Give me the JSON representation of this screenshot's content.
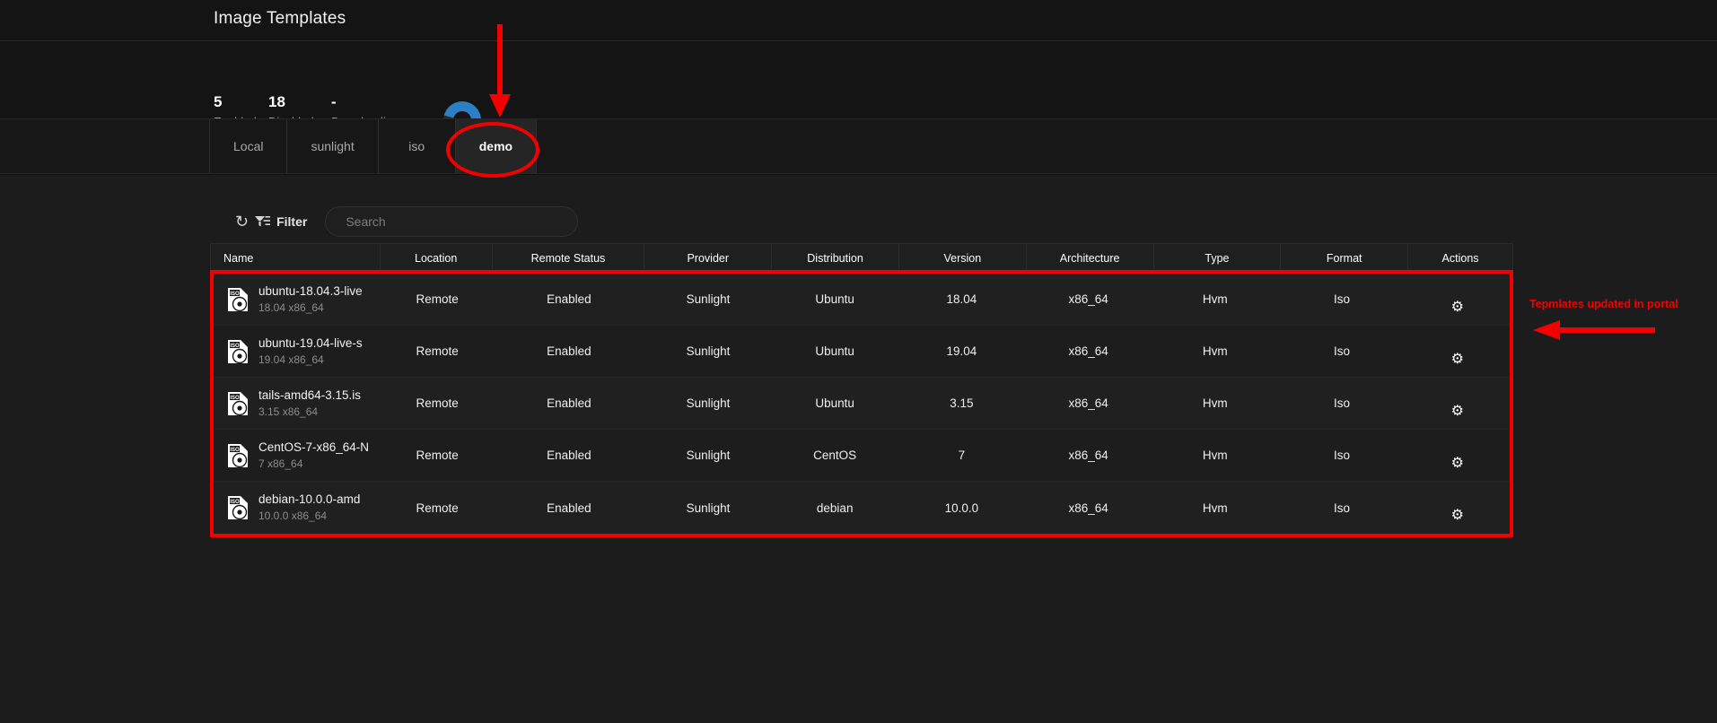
{
  "header": {
    "title": "Image Templates"
  },
  "stats": [
    {
      "value": "5",
      "label": "Enabled"
    },
    {
      "value": "18",
      "label": "Disabled"
    },
    {
      "value": "-",
      "label": "Downloading"
    }
  ],
  "donut": {
    "icon": "donut-chart-icon",
    "color": "#2b7fc4",
    "track_color": "#2a2a2a"
  },
  "tabs": [
    {
      "label": "Local",
      "active": false
    },
    {
      "label": "sunlight",
      "active": false
    },
    {
      "label": "iso",
      "active": false
    },
    {
      "label": "demo",
      "active": true
    }
  ],
  "toolbar": {
    "refresh_icon": "refresh-icon",
    "filter_icon": "filter-icon",
    "filter_label": "Filter",
    "search_value": "",
    "search_placeholder": "Search"
  },
  "table": {
    "columns": [
      "Name",
      "Location",
      "Remote Status",
      "Provider",
      "Distribution",
      "Version",
      "Architecture",
      "Type",
      "Format",
      "Actions"
    ],
    "rows": [
      {
        "icon": "iso-file-icon",
        "name": "ubuntu-18.04.3-live",
        "subtitle": "18.04 x86_64",
        "location": "Remote",
        "remote_status": "Enabled",
        "provider": "Sunlight",
        "distribution": "Ubuntu",
        "version": "18.04",
        "architecture": "x86_64",
        "type": "Hvm",
        "format": "Iso",
        "action_icon": "gear-icon"
      },
      {
        "icon": "iso-file-icon",
        "name": "ubuntu-19.04-live-s",
        "subtitle": "19.04 x86_64",
        "location": "Remote",
        "remote_status": "Enabled",
        "provider": "Sunlight",
        "distribution": "Ubuntu",
        "version": "19.04",
        "architecture": "x86_64",
        "type": "Hvm",
        "format": "Iso",
        "action_icon": "gear-icon"
      },
      {
        "icon": "iso-file-icon",
        "name": "tails-amd64-3.15.is",
        "subtitle": "3.15 x86_64",
        "location": "Remote",
        "remote_status": "Enabled",
        "provider": "Sunlight",
        "distribution": "Ubuntu",
        "version": "3.15",
        "architecture": "x86_64",
        "type": "Hvm",
        "format": "Iso",
        "action_icon": "gear-icon"
      },
      {
        "icon": "iso-file-icon",
        "name": "CentOS-7-x86_64-N",
        "subtitle": "7 x86_64",
        "location": "Remote",
        "remote_status": "Enabled",
        "provider": "Sunlight",
        "distribution": "CentOS",
        "version": "7",
        "architecture": "x86_64",
        "type": "Hvm",
        "format": "Iso",
        "action_icon": "gear-icon"
      },
      {
        "icon": "iso-file-icon",
        "name": "debian-10.0.0-amd",
        "subtitle": "10.0.0 x86_64",
        "location": "Remote",
        "remote_status": "Enabled",
        "provider": "Sunlight",
        "distribution": "debian",
        "version": "10.0.0",
        "architecture": "x86_64",
        "type": "Hvm",
        "format": "Iso",
        "action_icon": "gear-icon"
      }
    ]
  },
  "annotations": {
    "color": "#f40000",
    "arrow_down_icon": "down-arrow-annotation",
    "ellipse_icon": "ellipse-annotation",
    "note_text": "Tepmlates updated in portal",
    "left_arrow_icon": "left-arrow-annotation"
  }
}
